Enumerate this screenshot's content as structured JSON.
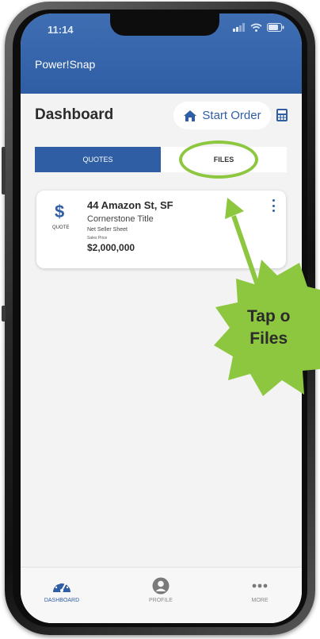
{
  "status_bar": {
    "time": "11:14"
  },
  "app": {
    "title": "Power!Snap"
  },
  "dashboard": {
    "title": "Dashboard",
    "start_order_label": "Start Order"
  },
  "tabs": [
    {
      "label": "QUOTES",
      "selected": true
    },
    {
      "label": "FILES",
      "selected": false
    }
  ],
  "quote_card": {
    "icon_symbol": "$",
    "icon_label": "QUOTE",
    "address": "44 Amazon St, SF",
    "company": "Cornerstone Title",
    "document": "Net Seller Sheet",
    "price_label": "Sales Price",
    "price": "$2,000,000"
  },
  "callout": {
    "line1": "Tap o",
    "line2": "Files"
  },
  "tab_bar": [
    {
      "label": "DASHBOARD",
      "icon": "dashboard-gauge-icon",
      "active": true
    },
    {
      "label": "PROFILE",
      "icon": "profile-icon",
      "active": false
    },
    {
      "label": "MORE",
      "icon": "more-icon",
      "active": false
    }
  ],
  "colors": {
    "primary": "#2f5ea5",
    "highlight_green": "#8dc63f",
    "background": "#f3f3f3"
  }
}
